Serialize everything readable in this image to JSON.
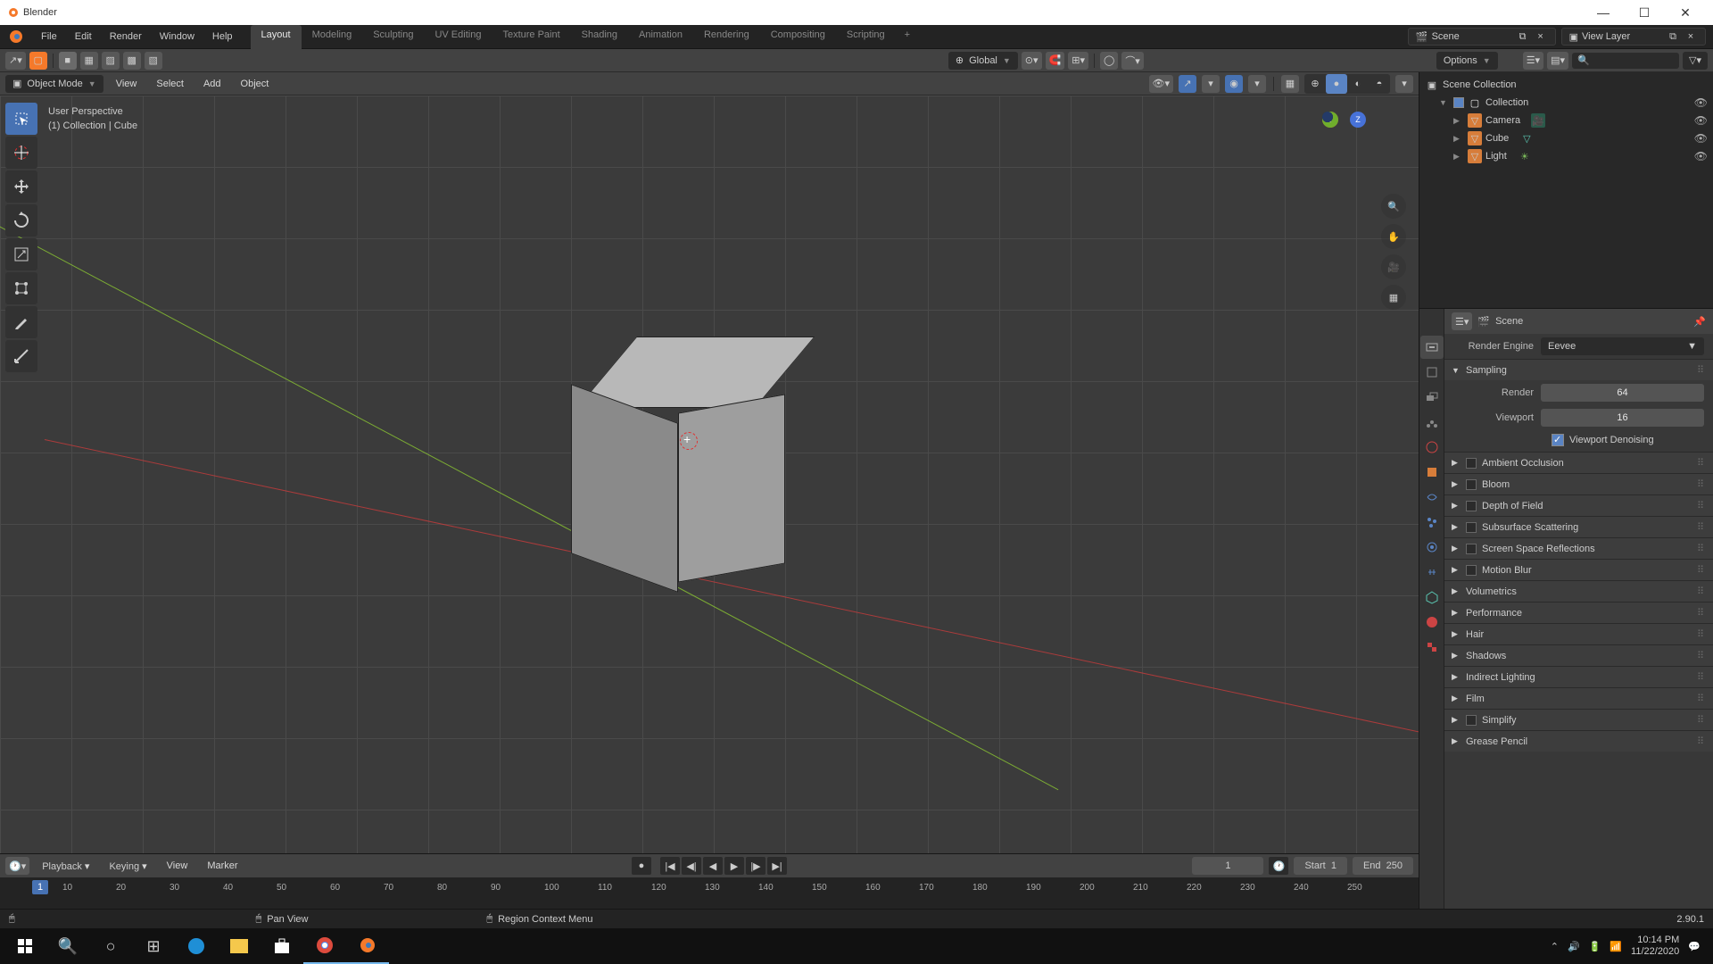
{
  "window_title": "Blender",
  "top_menu": [
    "File",
    "Edit",
    "Render",
    "Window",
    "Help"
  ],
  "workspaces": [
    "Layout",
    "Modeling",
    "Sculpting",
    "UV Editing",
    "Texture Paint",
    "Shading",
    "Animation",
    "Rendering",
    "Compositing",
    "Scripting"
  ],
  "scene_field": "Scene",
  "viewlayer_field": "View Layer",
  "viewport": {
    "mode": "Object Mode",
    "menus": [
      "View",
      "Select",
      "Add",
      "Object"
    ],
    "orientation": "Global",
    "options_label": "Options",
    "persp_text": "User Perspective",
    "context_text": "(1) Collection | Cube",
    "nav_icons": [
      "zoom-icon",
      "pan-icon",
      "camera-icon",
      "grid-toggle-icon"
    ]
  },
  "toolbar_tools": [
    "select-box",
    "cursor",
    "move",
    "rotate",
    "scale",
    "transform",
    "annotate",
    "measure"
  ],
  "outliner": {
    "root": "Scene Collection",
    "collection": "Collection",
    "items": [
      "Camera",
      "Cube",
      "Light"
    ]
  },
  "properties": {
    "scene_crumb": "Scene",
    "render_engine_label": "Render Engine",
    "render_engine": "Eevee",
    "sampling": {
      "title": "Sampling",
      "render_label": "Render",
      "render": "64",
      "viewport_label": "Viewport",
      "viewport": "16",
      "denoise": "Viewport Denoising"
    },
    "panels": [
      "Ambient Occlusion",
      "Bloom",
      "Depth of Field",
      "Subsurface Scattering",
      "Screen Space Reflections",
      "Motion Blur",
      "Volumetrics",
      "Performance",
      "Hair",
      "Shadows",
      "Indirect Lighting",
      "Film",
      "Simplify",
      "Grease Pencil"
    ]
  },
  "timeline": {
    "menus": [
      "Playback",
      "Keying",
      "View",
      "Marker"
    ],
    "current": "1",
    "start_label": "Start",
    "start": "1",
    "end_label": "End",
    "end": "250",
    "ticks": [
      "10",
      "20",
      "30",
      "40",
      "50",
      "60",
      "70",
      "80",
      "90",
      "100",
      "110",
      "120",
      "130",
      "140",
      "150",
      "160",
      "170",
      "180",
      "190",
      "200",
      "210",
      "220",
      "230",
      "240",
      "250"
    ]
  },
  "status": {
    "pan": "Pan View",
    "context": "Region Context Menu",
    "version": "2.90.1"
  },
  "taskbar": {
    "time": "10:14 PM",
    "date": "11/22/2020"
  }
}
